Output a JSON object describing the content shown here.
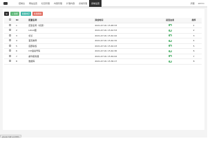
{
  "nav": {
    "items": [
      "控制台",
      "网站设置",
      "栏目管理",
      "内容管理",
      "扩展内容",
      "系统管理",
      "系统设置"
    ],
    "active_index": 6
  },
  "tools": {
    "clear_label": "清理",
    "user_label": "admin"
  },
  "toolbar": {
    "icon_label": "⊞",
    "add_label": "+ 新增",
    "batch_label": "批量排序",
    "delete_label": "批量删除"
  },
  "table": {
    "headers": [
      "",
      "ID",
      "配置名称",
      "添加时间",
      "是否启用",
      "排序"
    ],
    "rows": [
      [
        "1",
        "配置名称（标题）",
        "2021-07-01 15:48:33",
        "1"
      ],
      [
        "2",
        "LOGO图",
        "2021-07-01 15:42:53",
        "2"
      ],
      [
        "3",
        "标识",
        "2021-07-01 15:42:42",
        "3"
      ],
      [
        "4",
        "首页推荐",
        "2021-07-01 15:44:32",
        "4"
      ],
      [
        "5",
        "底部版权",
        "2021-07-01 15:44:23",
        "5"
      ],
      [
        "6",
        "ICP备案号码",
        "2021-07-01 15:44:36",
        "6"
      ],
      [
        "7",
        "邮件服务器",
        "2021-07-01 15:49:02",
        "7"
      ],
      [
        "8",
        "数据库",
        "2021-07-01 15:36:17",
        "8"
      ]
    ]
  },
  "status": {
    "url": "javascript:void(0);"
  },
  "colors": {
    "active_nav": "#2f2f2f",
    "green": "#5fb878",
    "teal": "#3eb6a7",
    "red": "#e06b5e"
  }
}
